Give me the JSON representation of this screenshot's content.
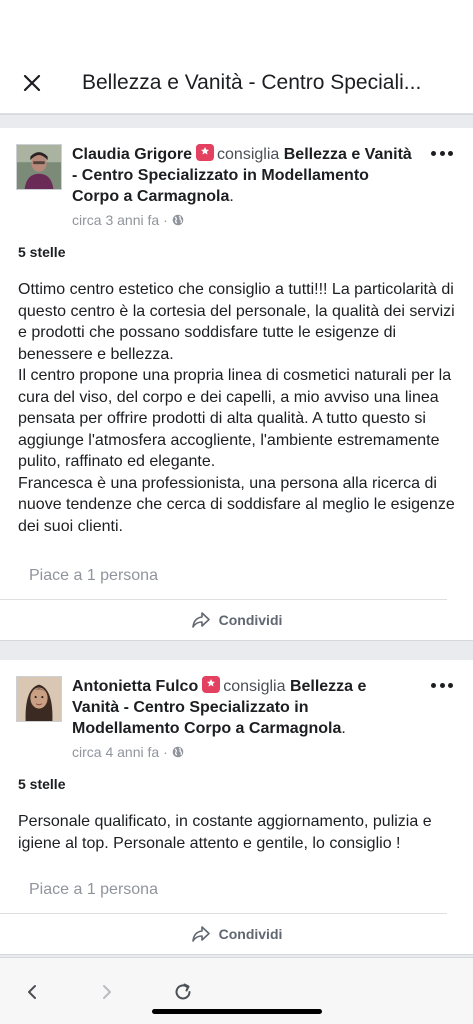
{
  "header": {
    "title": "Bellezza e Vanità - Centro Speciali...",
    "close_icon": "close-icon"
  },
  "reviews": [
    {
      "author": "Claudia Grigore",
      "verb": "consiglia",
      "page": "Bellezza e Vanità - Centro Specializzato in Modellamento Corpo a Carmagnola",
      "period": ".",
      "time": "circa 3 anni fa",
      "rating": "5 stelle",
      "paragraphs": [
        "Ottimo centro estetico che consiglio a tutti!!! La particolarità di questo centro è la cortesia del personale, la qualità dei servizi e prodotti che possano soddisfare tutte le esigenze di benessere e bellezza.",
        "Il centro propone una propria linea di cosmetici naturali per la cura del viso, del corpo e dei capelli, a mio avviso una linea pensata per offrire prodotti di alta qualità. A tutto questo si aggiunge l'atmosfera accogliente, l'ambiente estremamente pulito, raffinato ed elegante.",
        "Francesca è una professionista, una persona alla ricerca di nuove tendenze che cerca di soddisfare al meglio le esigenze dei suoi clienti."
      ],
      "likes": "Piace a 1 persona",
      "share": "Condividi"
    },
    {
      "author": "Antonietta Fulco",
      "verb": "consiglia",
      "page": "Bellezza e Vanità - Centro Specializzato in Modellamento Corpo a Carmagnola",
      "period": ".",
      "time": "circa 4 anni fa",
      "rating": "5 stelle",
      "paragraphs": [
        "Personale qualificato, in costante aggiornamento, pulizia e igiene al top. Personale attento e gentile, lo consiglio !"
      ],
      "likes": "Piace a 1 persona",
      "share": "Condividi"
    }
  ],
  "colors": {
    "accent_badge": "#e4405f",
    "separator": "#e9ebee",
    "muted_text": "#90949c"
  }
}
